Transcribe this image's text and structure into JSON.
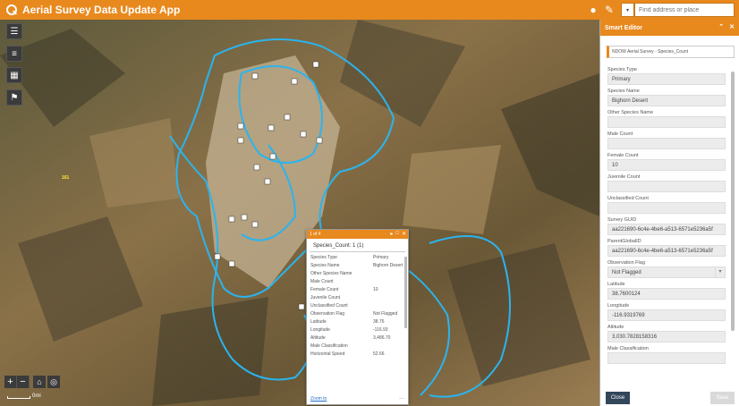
{
  "header": {
    "title": "Aerial Survey Data Update App",
    "search_placeholder": "Find address or place"
  },
  "map": {
    "label": "161",
    "scale_label": "0mi"
  },
  "popup": {
    "header": "1 of 4",
    "title": "Species_Count: 1 (1)",
    "rows": [
      {
        "k": "Species Type",
        "v": "Primary"
      },
      {
        "k": "Species Name",
        "v": "Bighorn Desert"
      },
      {
        "k": "Other Species Name",
        "v": ""
      },
      {
        "k": "Male Count",
        "v": ""
      },
      {
        "k": "Female Count",
        "v": "10"
      },
      {
        "k": "Juvenile Count",
        "v": ""
      },
      {
        "k": "Unclassified Count",
        "v": ""
      },
      {
        "k": "Observation Flag",
        "v": "Not Flagged"
      },
      {
        "k": "Latitude",
        "v": "38.76"
      },
      {
        "k": "Longitude",
        "v": "-116.93"
      },
      {
        "k": "Altitude",
        "v": "3,486.70"
      },
      {
        "k": "Male Classification",
        "v": ""
      },
      {
        "k": "Horizontal Speed",
        "v": "52.66"
      }
    ],
    "zoom_link": "Zoom to"
  },
  "panel": {
    "title": "Smart Editor",
    "layer": "NDOW Aerial Survey - Species_Count",
    "fields": [
      {
        "label": "Species Type",
        "value": "Primary",
        "type": "input"
      },
      {
        "label": "Species Name",
        "value": "Bighorn Desert",
        "type": "input"
      },
      {
        "label": "Other Species Name",
        "value": "",
        "type": "input"
      },
      {
        "label": "Male Count",
        "value": "",
        "type": "input"
      },
      {
        "label": "Female Count",
        "value": "10",
        "type": "input"
      },
      {
        "label": "Juvenile Count",
        "value": "",
        "type": "input"
      },
      {
        "label": "Unclassified Count",
        "value": "",
        "type": "input"
      },
      {
        "label": "Survey GUID",
        "value": "aa221690-6c4e-4be6-a513-6571e5236a5f",
        "type": "input"
      },
      {
        "label": "ParentGlobalID",
        "value": "aa221690-6c4e-4be6-a513-6571e5236a5f",
        "type": "input"
      },
      {
        "label": "Observation Flag",
        "value": "Not Flagged",
        "type": "select"
      },
      {
        "label": "Latitude",
        "value": "38.7600124",
        "type": "input"
      },
      {
        "label": "Longitude",
        "value": "-116.9319769",
        "type": "input"
      },
      {
        "label": "Altitude",
        "value": "3,030.7828158316",
        "type": "input"
      },
      {
        "label": "Male Classification",
        "value": "",
        "type": "input"
      }
    ],
    "close_label": "Close",
    "save_label": "Save"
  }
}
